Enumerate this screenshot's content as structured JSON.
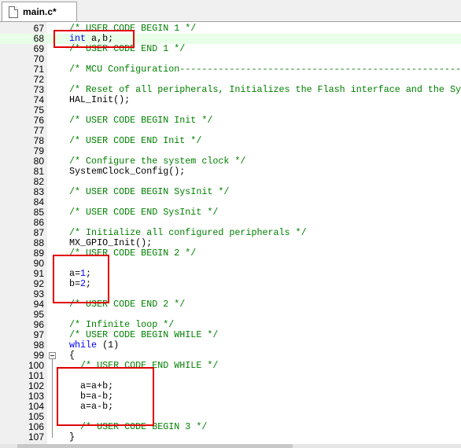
{
  "tab": {
    "label": "main.c*",
    "icon": "c-file-icon"
  },
  "lines": [
    {
      "n": "67",
      "tokens": [
        {
          "t": "/* USER CODE BEGIN 1 */",
          "c": "cm"
        }
      ]
    },
    {
      "n": "68",
      "tokens": [
        {
          "t": "int",
          "c": "kw"
        },
        {
          "t": " a,b;",
          "c": "pl"
        }
      ]
    },
    {
      "n": "69",
      "tokens": [
        {
          "t": "/* USER CODE END 1 */",
          "c": "cm"
        }
      ]
    },
    {
      "n": "70",
      "tokens": []
    },
    {
      "n": "71",
      "tokens": [
        {
          "t": "/* MCU Configuration--------------------------------------------------------",
          "c": "cm"
        }
      ]
    },
    {
      "n": "72",
      "tokens": []
    },
    {
      "n": "73",
      "tokens": [
        {
          "t": "/* Reset of all peripherals, Initializes the Flash interface and the Systick. */",
          "c": "cm"
        }
      ]
    },
    {
      "n": "74",
      "tokens": [
        {
          "t": "HAL_Init();",
          "c": "pl"
        }
      ]
    },
    {
      "n": "75",
      "tokens": []
    },
    {
      "n": "76",
      "tokens": [
        {
          "t": "/* USER CODE BEGIN Init */",
          "c": "cm"
        }
      ]
    },
    {
      "n": "77",
      "tokens": []
    },
    {
      "n": "78",
      "tokens": [
        {
          "t": "/* USER CODE END Init */",
          "c": "cm"
        }
      ]
    },
    {
      "n": "79",
      "tokens": []
    },
    {
      "n": "80",
      "tokens": [
        {
          "t": "/* Configure the system clock */",
          "c": "cm"
        }
      ]
    },
    {
      "n": "81",
      "tokens": [
        {
          "t": "SystemClock_Config();",
          "c": "pl"
        }
      ]
    },
    {
      "n": "82",
      "tokens": []
    },
    {
      "n": "83",
      "tokens": [
        {
          "t": "/* USER CODE BEGIN SysInit */",
          "c": "cm"
        }
      ]
    },
    {
      "n": "84",
      "tokens": []
    },
    {
      "n": "85",
      "tokens": [
        {
          "t": "/* USER CODE END SysInit */",
          "c": "cm"
        }
      ]
    },
    {
      "n": "86",
      "tokens": []
    },
    {
      "n": "87",
      "tokens": [
        {
          "t": "/* Initialize all configured peripherals */",
          "c": "cm"
        }
      ]
    },
    {
      "n": "88",
      "tokens": [
        {
          "t": "MX_GPIO_Init();",
          "c": "pl"
        }
      ]
    },
    {
      "n": "89",
      "tokens": [
        {
          "t": "/* USER CODE BEGIN 2 */",
          "c": "cm"
        }
      ]
    },
    {
      "n": "90",
      "tokens": []
    },
    {
      "n": "91",
      "tokens": [
        {
          "t": "a=",
          "c": "pl"
        },
        {
          "t": "1",
          "c": "kw"
        },
        {
          "t": ";",
          "c": "pl"
        }
      ]
    },
    {
      "n": "92",
      "tokens": [
        {
          "t": "b=",
          "c": "pl"
        },
        {
          "t": "2",
          "c": "kw"
        },
        {
          "t": ";",
          "c": "pl"
        }
      ]
    },
    {
      "n": "93",
      "tokens": []
    },
    {
      "n": "94",
      "tokens": [
        {
          "t": "/* USER CODE END 2 */",
          "c": "cm"
        }
      ]
    },
    {
      "n": "95",
      "tokens": []
    },
    {
      "n": "96",
      "tokens": [
        {
          "t": "/* Infinite loop */",
          "c": "cm"
        }
      ]
    },
    {
      "n": "97",
      "tokens": [
        {
          "t": "/* USER CODE BEGIN WHILE */",
          "c": "cm"
        }
      ]
    },
    {
      "n": "98",
      "tokens": [
        {
          "t": "while",
          "c": "kw"
        },
        {
          "t": " (1)",
          "c": "pl"
        }
      ]
    },
    {
      "n": "99",
      "tokens": [
        {
          "t": "{",
          "c": "pl"
        }
      ]
    },
    {
      "n": "100",
      "tokens": [
        {
          "t": "  /* USER CODE END WHILE */",
          "c": "cm"
        }
      ]
    },
    {
      "n": "101",
      "tokens": []
    },
    {
      "n": "102",
      "tokens": [
        {
          "t": "  a=a+b;",
          "c": "pl"
        }
      ]
    },
    {
      "n": "103",
      "tokens": [
        {
          "t": "  b=a-b;",
          "c": "pl"
        }
      ]
    },
    {
      "n": "104",
      "tokens": [
        {
          "t": "  a=a-b;",
          "c": "pl"
        }
      ]
    },
    {
      "n": "105",
      "tokens": []
    },
    {
      "n": "106",
      "tokens": [
        {
          "t": "  /* USER CODE BEGIN 3 */",
          "c": "cm"
        }
      ]
    },
    {
      "n": "107",
      "tokens": [
        {
          "t": "}",
          "c": "pl"
        }
      ]
    }
  ],
  "current_line": "68",
  "colors": {
    "comment": "#008000",
    "keyword": "#0000ff",
    "highlight_box": "#e00000",
    "current_line_bg": "#e8ffe8"
  }
}
